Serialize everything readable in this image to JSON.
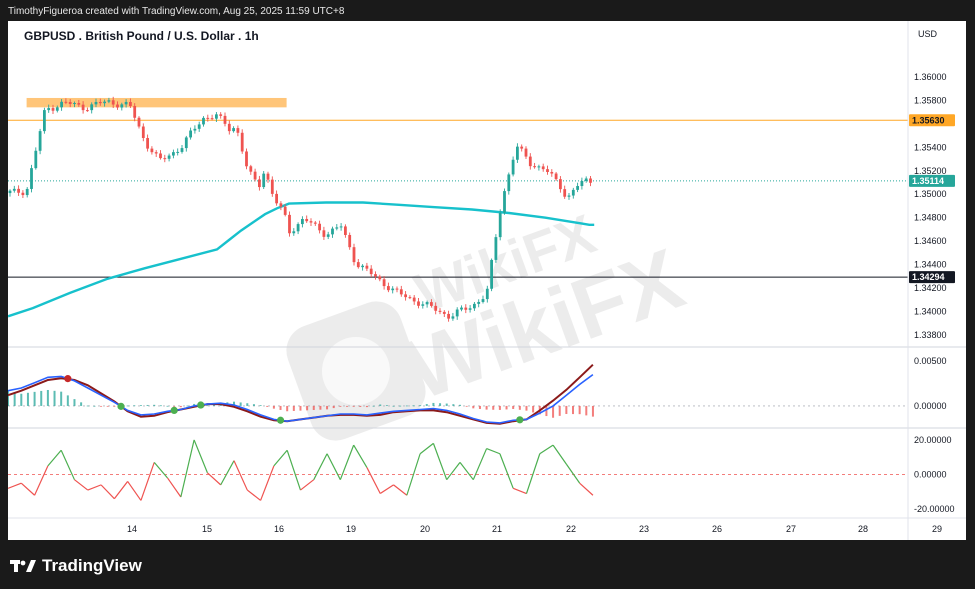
{
  "header": {
    "attribution": "TimothyFigueroa created with TradingView.com, Aug 25, 2025 11:59 UTC+8"
  },
  "footer": {
    "brand": "TradingView"
  },
  "watermark": {
    "text": "WikiFX"
  },
  "chart_data": [
    {
      "type": "candlestick",
      "title": "GBPUSD . British Pound / U.S. Dollar . 1h",
      "currency": "USD",
      "x_ticks": [
        "14",
        "15",
        "16",
        "19",
        "20",
        "21",
        "22",
        "23",
        "26",
        "27",
        "28",
        "29"
      ],
      "y_ticks": [
        "1.36000",
        "1.35800",
        "1.35400",
        "1.35200",
        "1.35000",
        "1.34800",
        "1.34600",
        "1.34400",
        "1.34200",
        "1.34000",
        "1.33800"
      ],
      "ylim": [
        1.3375,
        1.3622
      ],
      "grid": false,
      "colors": {
        "up": "#26a69a",
        "down": "#ef5350",
        "ma": "#17c1cc",
        "resistance": "#ffb24c"
      },
      "price_levels": [
        {
          "label": "1.35630",
          "value": 1.3563,
          "color": "#ffa726",
          "style": "solid"
        },
        {
          "label": "1.35114",
          "value": 1.35114,
          "color": "#26a69a",
          "style": "dotted"
        },
        {
          "label": "1.34294",
          "value": 1.34294,
          "color": "#131722",
          "style": "solid"
        }
      ],
      "resistance_zone": {
        "from": 1.3574,
        "to": 1.3582,
        "start_day": "13.3",
        "end_day": "18.9"
      },
      "moving_average": {
        "x": [
          13.0,
          13.4,
          14.0,
          14.5,
          15.0,
          15.5,
          16.0,
          16.5,
          17.0,
          17.5,
          18.0,
          18.5,
          19.0,
          19.5,
          20.0,
          20.5,
          21.0,
          21.5,
          22.0,
          22.5,
          23.0,
          23.3,
          23.5
        ],
        "y": [
          1.3396,
          1.3403,
          1.3416,
          1.3428,
          1.3437,
          1.3445,
          1.3453,
          1.3461,
          1.3469,
          1.3476,
          1.3483,
          1.3488,
          1.3492,
          1.3493,
          1.3493,
          1.3491,
          1.3489,
          1.3487,
          1.3484,
          1.348,
          1.3475,
          1.3474,
          1.3474
        ]
      },
      "price_path": {
        "x": [
          13.0,
          13.3,
          13.6,
          13.9,
          14.2,
          14.5,
          14.8,
          15.0,
          15.2,
          15.5,
          15.8,
          16.0,
          16.2,
          16.5,
          16.8,
          17.0,
          17.2,
          17.5,
          17.8,
          18.0,
          18.2,
          18.5,
          18.8,
          19.0,
          19.2,
          19.5,
          19.7,
          19.9,
          20.2,
          20.5,
          20.7,
          21.0,
          21.2,
          21.5,
          21.7,
          21.9,
          22.1,
          22.3,
          22.5,
          22.7,
          22.8,
          22.95,
          23.1,
          23.3,
          23.45
        ],
        "y": [
          1.3501,
          1.3503,
          1.3572,
          1.3578,
          1.3574,
          1.3579,
          1.3575,
          1.3545,
          1.3528,
          1.354,
          1.3565,
          1.3567,
          1.3562,
          1.3556,
          1.3558,
          1.3542,
          1.3525,
          1.3512,
          1.3508,
          1.3524,
          1.3505,
          1.3492,
          1.3483,
          1.3468,
          1.3479,
          1.3466,
          1.3473,
          1.3442,
          1.3428,
          1.3415,
          1.341,
          1.3402,
          1.3396,
          1.3405,
          1.3415,
          1.3494,
          1.3541,
          1.3526,
          1.3521,
          1.3507,
          1.3497,
          1.3508,
          1.3511,
          1.3511,
          1.3511
        ]
      }
    },
    {
      "type": "line",
      "indicator": "macd",
      "y_ticks": [
        "0.00500",
        "0.00000"
      ],
      "ylim": [
        -0.0028,
        0.0058
      ],
      "series": [
        {
          "color": "#2962ff",
          "y": [
            0.0017,
            0.002,
            0.0026,
            0.0032,
            0.0033,
            0.0028,
            0.002,
            0.0012,
            0.0004,
            -0.0005,
            -0.001,
            -0.0009,
            -0.0006,
            -0.0004,
            0.0,
            0.0002,
            0.0003,
            0.0001,
            -0.0004,
            -0.001,
            -0.0015,
            -0.0017,
            -0.0015,
            -0.0013,
            -0.0011,
            -0.0009,
            -0.0009,
            -0.001,
            -0.0008,
            -0.0006,
            -0.0005,
            -0.0004,
            -0.0003,
            -0.0005,
            -0.0009,
            -0.0014,
            -0.0018,
            -0.0019,
            -0.0016,
            -0.0015,
            -0.0008,
            0.0,
            0.0012,
            0.0024,
            0.0035
          ]
        },
        {
          "color": "#8b1a1a",
          "y": [
            0.0012,
            0.0017,
            0.0023,
            0.0029,
            0.0031,
            0.0029,
            0.0023,
            0.0014,
            0.0005,
            -0.0006,
            -0.0012,
            -0.0011,
            -0.0007,
            -0.0004,
            -0.0001,
            0.0002,
            0.0002,
            -0.0001,
            -0.0006,
            -0.0012,
            -0.0016,
            -0.0017,
            -0.0015,
            -0.0013,
            -0.0011,
            -0.001,
            -0.001,
            -0.0011,
            -0.001,
            -0.0007,
            -0.0006,
            -0.0005,
            -0.0005,
            -0.0007,
            -0.0011,
            -0.0015,
            -0.0019,
            -0.002,
            -0.0017,
            -0.0015,
            -0.0005,
            0.0006,
            0.0018,
            0.0032,
            0.0046
          ]
        }
      ]
    },
    {
      "type": "line",
      "indicator": "oscillator",
      "y_ticks": [
        "20.00000",
        "0.00000",
        "-20.00000"
      ],
      "ylim": [
        -24,
        24
      ],
      "zero_line_color": "#ef5350",
      "series": [
        {
          "color": "#4caf50",
          "y": [
            -8,
            -5,
            -12,
            5,
            14,
            -3,
            -9,
            -6,
            -14,
            -4,
            -15,
            7,
            -2,
            -13,
            20,
            1,
            -6,
            8,
            -9,
            -15,
            5,
            14,
            -9,
            -3,
            12,
            -3,
            17,
            4,
            -11,
            -6,
            -12,
            12,
            18,
            -3,
            7,
            -3,
            15,
            12,
            -8,
            -11,
            12,
            17,
            6,
            -5,
            -12
          ]
        }
      ]
    }
  ]
}
